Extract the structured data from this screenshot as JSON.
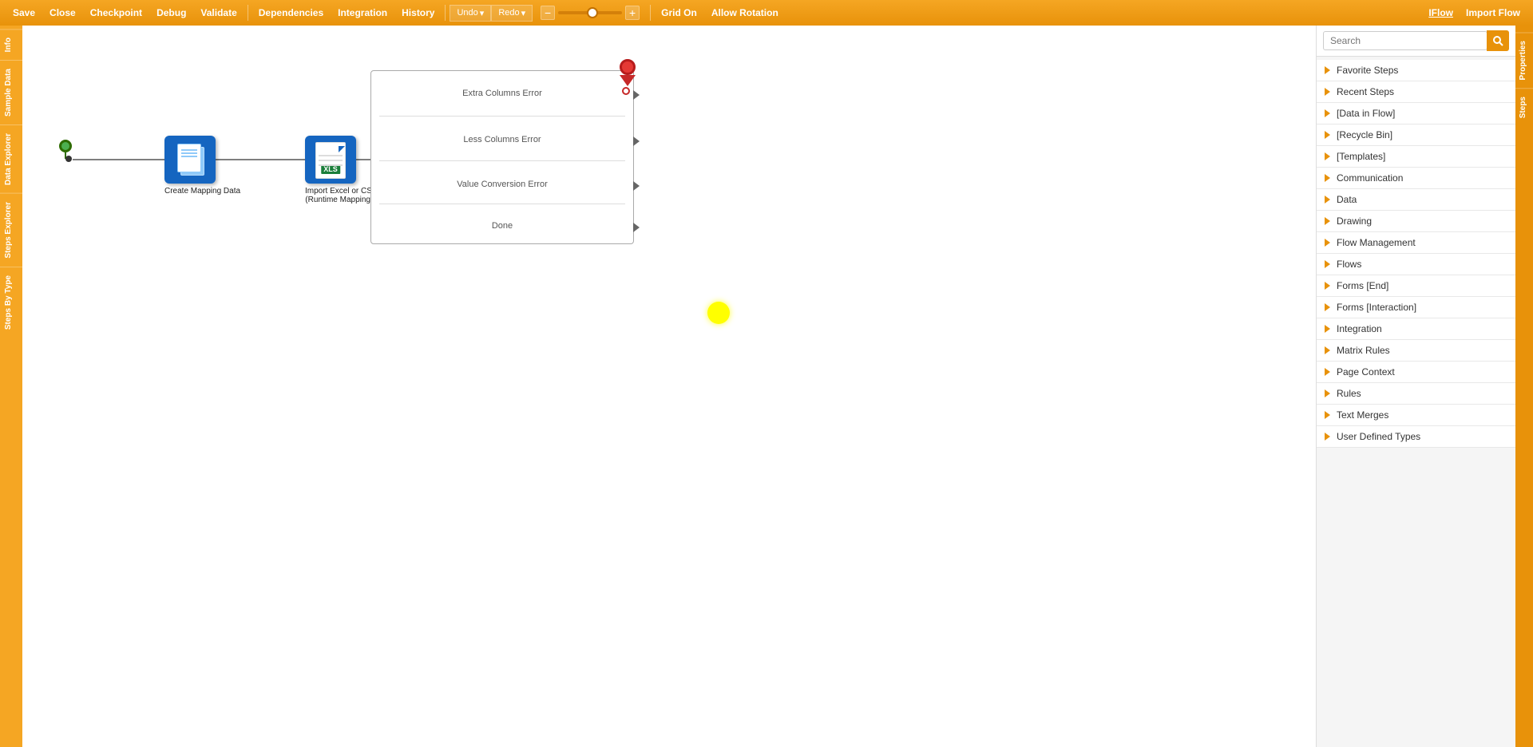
{
  "toolbar": {
    "save_label": "Save",
    "close_label": "Close",
    "checkpoint_label": "Checkpoint",
    "debug_label": "Debug",
    "validate_label": "Validate",
    "dependencies_label": "Dependencies",
    "integration_label": "Integration",
    "history_label": "History",
    "undo_label": "Undo",
    "redo_label": "Redo",
    "grid_on_label": "Grid On",
    "allow_rotation_label": "Allow Rotation",
    "iflow_label": "IFlow",
    "import_flow_label": "Import Flow"
  },
  "flow": {
    "start_node_label": "",
    "create_mapping_label": "Create Mapping Data",
    "import_excel_label": "Import Excel or CSV",
    "import_excel_sublabel": "(Runtime Mappings)",
    "output_labels": {
      "extra_columns_error": "Extra  Columns  Error",
      "less_columns_error": "Less  Columns  Error",
      "value_conversion_error": "Value  Conversion  Error",
      "done": "Done"
    }
  },
  "left_sidebar": {
    "tabs": [
      "Info",
      "Sample Data",
      "Data Explorer",
      "Steps Explorer",
      "Steps By Type"
    ]
  },
  "right_panel": {
    "search_placeholder": "Search",
    "search_button_label": "🔍",
    "categories": [
      {
        "label": "Favorite Steps"
      },
      {
        "label": "Recent Steps"
      },
      {
        "label": "[Data in Flow]"
      },
      {
        "label": "[Recycle Bin]"
      },
      {
        "label": "[Templates]"
      },
      {
        "label": "Communication"
      },
      {
        "label": "Data"
      },
      {
        "label": "Drawing"
      },
      {
        "label": "Flow Management"
      },
      {
        "label": "Flows"
      },
      {
        "label": "Forms [End]"
      },
      {
        "label": "Forms [Interaction]"
      },
      {
        "label": "Integration"
      },
      {
        "label": "Matrix Rules"
      },
      {
        "label": "Page Context"
      },
      {
        "label": "Rules"
      },
      {
        "label": "Text Merges"
      },
      {
        "label": "User Defined Types"
      }
    ],
    "right_tab_label": "Properties",
    "steps_tab_label": "Steps"
  }
}
